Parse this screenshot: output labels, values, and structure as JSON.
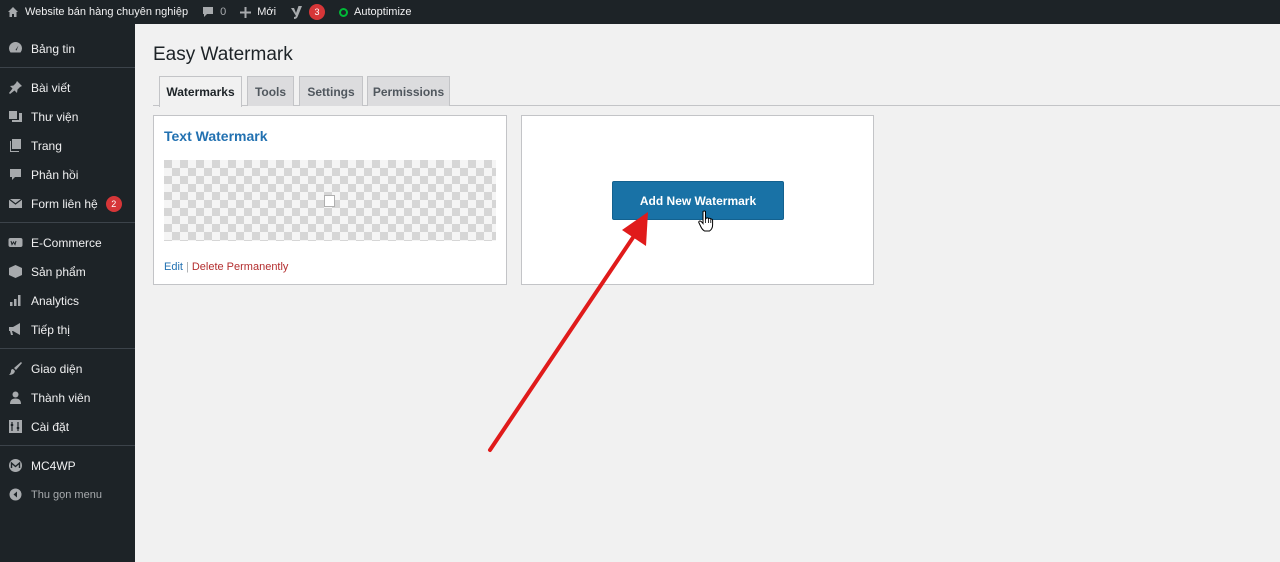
{
  "adminbar": {
    "site_name": "Website bán hàng chuyên nghiệp",
    "comments_count": "0",
    "new_label": "Mới",
    "seo_badge": "3",
    "autoptimize_label": "Autoptimize"
  },
  "sidebar": {
    "items": [
      {
        "label": "Bảng tin",
        "icon": "dashboard-icon"
      },
      {
        "label": "Bài viết",
        "icon": "pin-icon"
      },
      {
        "label": "Thư viện",
        "icon": "media-icon"
      },
      {
        "label": "Trang",
        "icon": "page-icon"
      },
      {
        "label": "Phản hồi",
        "icon": "comment-icon"
      },
      {
        "label": "Form liên hệ",
        "icon": "mail-icon",
        "badge": "2"
      },
      {
        "label": "E-Commerce",
        "icon": "woo-icon"
      },
      {
        "label": "Sản phẩm",
        "icon": "box-icon"
      },
      {
        "label": "Analytics",
        "icon": "bar-chart-icon"
      },
      {
        "label": "Tiếp thị",
        "icon": "megaphone-icon"
      },
      {
        "label": "Giao diện",
        "icon": "brush-icon"
      },
      {
        "label": "Thành viên",
        "icon": "user-icon"
      },
      {
        "label": "Cài đặt",
        "icon": "settings-icon"
      },
      {
        "label": "MC4WP",
        "icon": "mc4wp-icon"
      },
      {
        "label": "Thu gọn menu",
        "icon": "collapse-icon"
      }
    ]
  },
  "page": {
    "title": "Easy Watermark",
    "tabs": [
      {
        "label": "Watermarks",
        "active": true
      },
      {
        "label": "Tools"
      },
      {
        "label": "Settings"
      },
      {
        "label": "Permissions"
      }
    ]
  },
  "watermark_card": {
    "title": "Text Watermark",
    "edit_label": "Edit",
    "separator": "|",
    "delete_label": "Delete Permanently"
  },
  "add_card": {
    "button_label": "Add New Watermark"
  },
  "colors": {
    "accent": "#2271b1",
    "button": "#1972a6",
    "danger": "#b32d2e",
    "annotation_arrow": "#e01b1b",
    "sidebar_bg": "#1d2327"
  }
}
